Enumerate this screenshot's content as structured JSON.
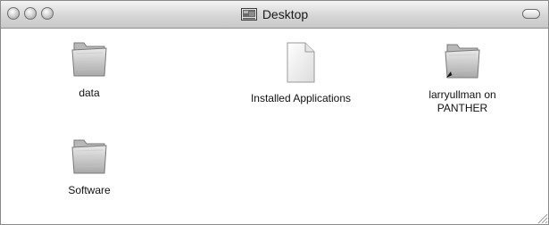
{
  "window": {
    "title": "Desktop"
  },
  "titlebar": {
    "title_icon": "desktop-window-icon"
  },
  "items": [
    {
      "label": "data",
      "icon": "folder-icon"
    },
    {
      "label": "Installed Applications",
      "icon": "document-icon"
    },
    {
      "label": "larryullman on PANTHER",
      "icon": "folder-alias-icon"
    },
    {
      "label": "Software",
      "icon": "folder-icon"
    }
  ]
}
